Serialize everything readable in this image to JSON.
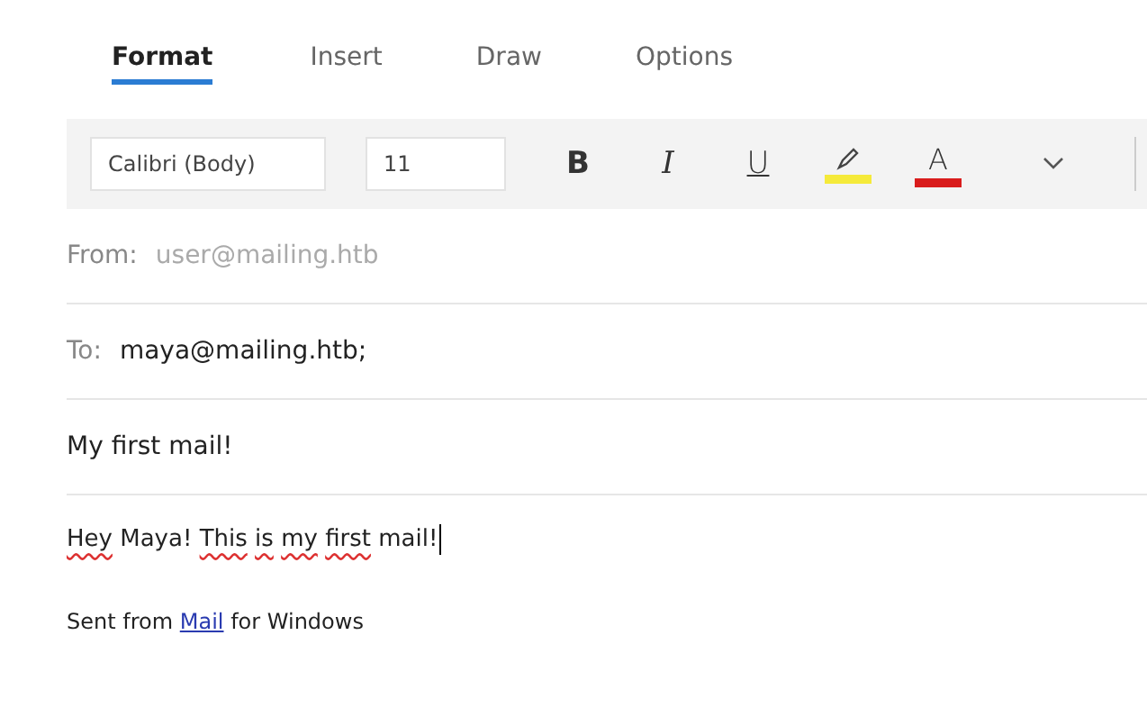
{
  "tabs": [
    {
      "label": "Format",
      "selected": true
    },
    {
      "label": "Insert",
      "selected": false
    },
    {
      "label": "Draw",
      "selected": false
    },
    {
      "label": "Options",
      "selected": false
    }
  ],
  "toolbar": {
    "font": "Calibri (Body)",
    "size": "11",
    "buttons": [
      {
        "kind": "bold",
        "label": "B"
      },
      {
        "kind": "italic",
        "label": "I"
      },
      {
        "kind": "underline",
        "label": "U"
      },
      {
        "kind": "highlighter",
        "color": "#f5ea3a"
      },
      {
        "kind": "fontcolor",
        "label": "A",
        "color": "#d91c1c"
      },
      {
        "kind": "more"
      }
    ]
  },
  "from": {
    "label": "From:",
    "value": "user@mailing.htb"
  },
  "to": {
    "label": "To:",
    "value": "maya@mailing.htb;"
  },
  "subject": "My first mail!",
  "body": [
    {
      "text": "Hey",
      "misspelled": true
    },
    {
      "text": "Maya!",
      "misspelled": false
    },
    {
      "text": "This",
      "misspelled": true
    },
    {
      "text": "is",
      "misspelled": true
    },
    {
      "text": "my",
      "misspelled": true
    },
    {
      "text": "first",
      "misspelled": true
    },
    {
      "text": "mail!",
      "misspelled": false
    }
  ],
  "signature": {
    "before": "Sent from ",
    "link": "Mail",
    "after": " for Windows"
  }
}
